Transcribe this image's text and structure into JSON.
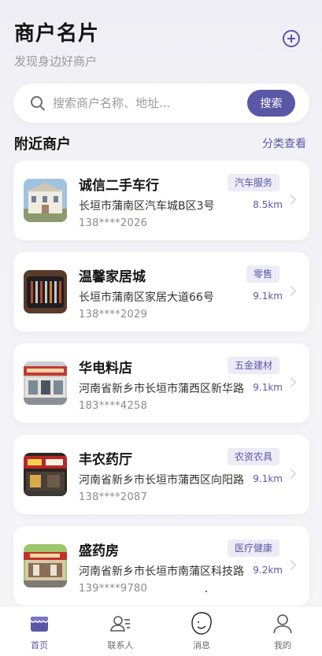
{
  "header": {
    "title": "商户名片",
    "subtitle": "发现身边好商户"
  },
  "search": {
    "placeholder": "搜索商户名称、地址...",
    "button_label": "搜索"
  },
  "section": {
    "title": "附近商户",
    "link_label": "分类查看"
  },
  "merchants": [
    {
      "name": "诚信二手车行",
      "tag": "汽车服务",
      "address": "长垣市蒲南区汽车城B区3号",
      "distance": "8.5km",
      "phone": "138****2026"
    },
    {
      "name": "温馨家居城",
      "tag": "零售",
      "address": "长垣市蒲南区家居大道66号",
      "distance": "9.1km",
      "phone": "138****2029"
    },
    {
      "name": "华电料店",
      "tag": "五金建材",
      "address": "河南省新乡市长垣市蒲西区新华路",
      "distance": "9.1km",
      "phone": "183****4258"
    },
    {
      "name": "丰农药厅",
      "tag": "农资农具",
      "address": "河南省新乡市长垣市蒲西区向阳路",
      "distance": "9.1km",
      "phone": "138****2087"
    },
    {
      "name": "盛药房",
      "tag": "医疗健康",
      "address": "河南省新乡市长垣市南蒲区科技路",
      "distance": "9.2km",
      "phone": "139****9780"
    }
  ],
  "tabs": [
    {
      "label": "首页",
      "icon": "shop-icon",
      "active": true
    },
    {
      "label": "联系人",
      "icon": "contacts-icon",
      "active": false
    },
    {
      "label": "消息",
      "icon": "message-icon",
      "active": false
    },
    {
      "label": "我的",
      "icon": "user-icon",
      "active": false
    }
  ],
  "colors": {
    "accent": "#5a58a6",
    "tag_bg": "#ecebf6",
    "background": "#f4f4f8"
  }
}
